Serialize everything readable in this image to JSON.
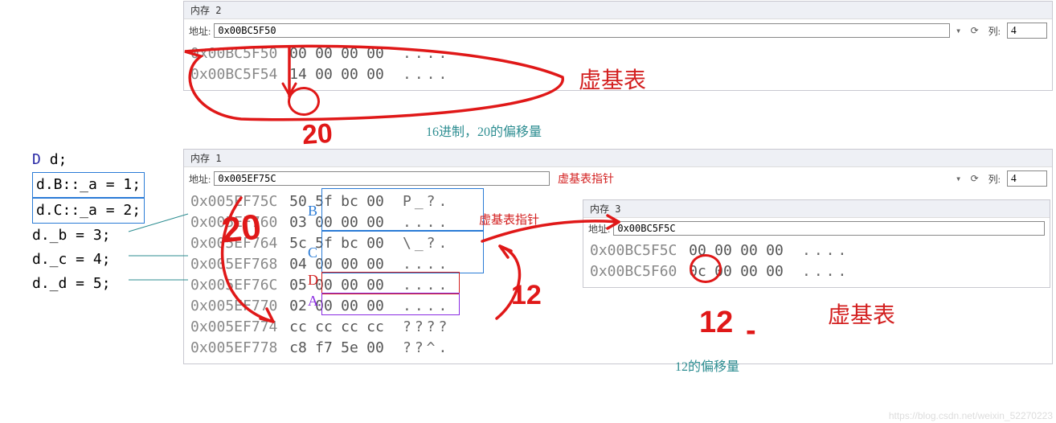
{
  "code": {
    "line0": "D d;",
    "line1": "d.B::_a = 1;",
    "line2": "d.C::_a = 2;",
    "line3": "d._b = 3;",
    "line4": "d._c = 4;",
    "line5": "d._d = 5;"
  },
  "mem2": {
    "title": "内存 2",
    "addr_label": "地址:",
    "addr_value": "0x00BC5F50",
    "col_label": "列:",
    "col_value": "4",
    "rows": [
      {
        "addr": "0x00BC5F50",
        "b": [
          "00",
          "00",
          "00",
          "00"
        ],
        "a": "...."
      },
      {
        "addr": "0x00BC5F54",
        "b": [
          "14",
          "00",
          "00",
          "00"
        ],
        "a": "...."
      }
    ]
  },
  "mem1": {
    "title": "内存 1",
    "addr_label": "地址:",
    "addr_value": "0x005EF75C",
    "col_label": "列:",
    "col_value": "4",
    "rows": [
      {
        "addr": "0x005EF75C",
        "b": [
          "50",
          "5f",
          "bc",
          "00"
        ],
        "a": "P_?."
      },
      {
        "addr": "0x005EF760",
        "b": [
          "03",
          "00",
          "00",
          "00"
        ],
        "a": "...."
      },
      {
        "addr": "0x005EF764",
        "b": [
          "5c",
          "5f",
          "bc",
          "00"
        ],
        "a": "\\_?."
      },
      {
        "addr": "0x005EF768",
        "b": [
          "04",
          "00",
          "00",
          "00"
        ],
        "a": "...."
      },
      {
        "addr": "0x005EF76C",
        "b": [
          "05",
          "00",
          "00",
          "00"
        ],
        "a": "...."
      },
      {
        "addr": "0x005EF770",
        "b": [
          "02",
          "00",
          "00",
          "00"
        ],
        "a": "...."
      },
      {
        "addr": "0x005EF774",
        "b": [
          "cc",
          "cc",
          "cc",
          "cc"
        ],
        "a": "????"
      },
      {
        "addr": "0x005EF778",
        "b": [
          "c8",
          "f7",
          "5e",
          "00"
        ],
        "a": "??^."
      }
    ],
    "inline_label": "虚基表指针"
  },
  "mem3": {
    "title": "内存 3",
    "addr_label": "地址:",
    "addr_value": "0x00BC5F5C",
    "rows": [
      {
        "addr": "0x00BC5F5C",
        "b": [
          "00",
          "00",
          "00",
          "00"
        ],
        "a": "...."
      },
      {
        "addr": "0x00BC5F60",
        "b": [
          "0c",
          "00",
          "00",
          "00"
        ],
        "a": "...."
      }
    ]
  },
  "ann": {
    "vbt": "虚基表",
    "hex20": "16进制，20的偏移量",
    "ptr": "虚基表指针",
    "off12": "12的偏移量",
    "h20": "20",
    "h12": "12",
    "h12b": "12"
  },
  "letters": {
    "B": "B",
    "C": "C",
    "D": "D",
    "A": "A"
  },
  "watermark": "https://blog.csdn.net/weixin_52270223"
}
